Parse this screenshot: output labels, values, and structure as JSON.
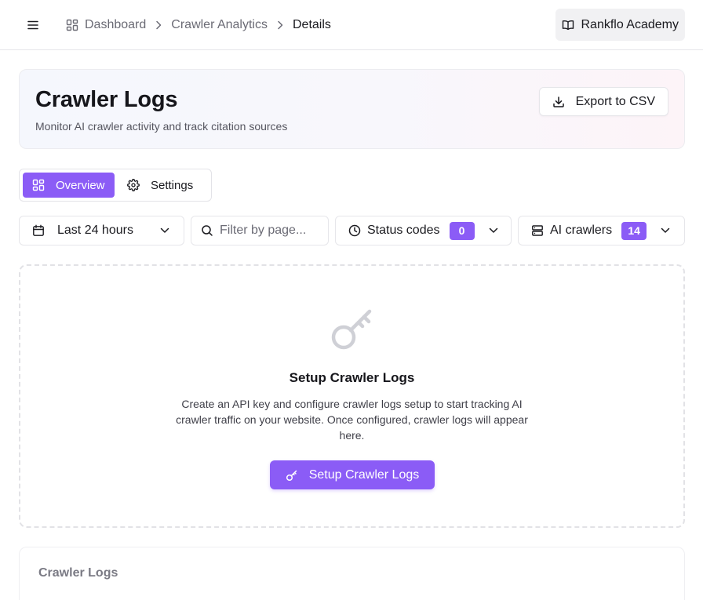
{
  "breadcrumb": {
    "items": [
      {
        "label": "Dashboard"
      },
      {
        "label": "Crawler Analytics"
      },
      {
        "label": "Details"
      }
    ]
  },
  "header": {
    "academy_label": "Rankflo Academy"
  },
  "hero": {
    "title": "Crawler Logs",
    "subtitle": "Monitor AI crawler activity and track citation sources",
    "export_label": "Export to CSV"
  },
  "tabs": [
    {
      "label": "Overview",
      "active": true
    },
    {
      "label": "Settings",
      "active": false
    }
  ],
  "filters": {
    "date_range": "Last 24 hours",
    "search_placeholder": "Filter by page...",
    "status_label": "Status codes",
    "status_count": "0",
    "crawlers_label": "AI crawlers",
    "crawlers_count": "14"
  },
  "empty_state": {
    "title": "Setup Crawler Logs",
    "description": "Create an API key and configure crawler logs setup to start tracking AI crawler traffic on your website. Once configured, crawler logs will appear here.",
    "button_label": "Setup Crawler Logs"
  },
  "logs_section": {
    "title": "Crawler Logs"
  },
  "colors": {
    "accent": "#8b5cf6",
    "border": "#e6e6ea",
    "muted_text": "#6b6b75"
  },
  "icons": {
    "menu": "hamburger-icon",
    "dashboard": "dashboard-grid-icon",
    "chevron": "chevron-right-icon",
    "academy": "book-open-icon",
    "export": "download-icon",
    "settings": "gear-icon",
    "calendar": "calendar-icon",
    "search": "search-icon",
    "clock": "clock-icon",
    "server": "server-icon",
    "key": "key-icon"
  }
}
